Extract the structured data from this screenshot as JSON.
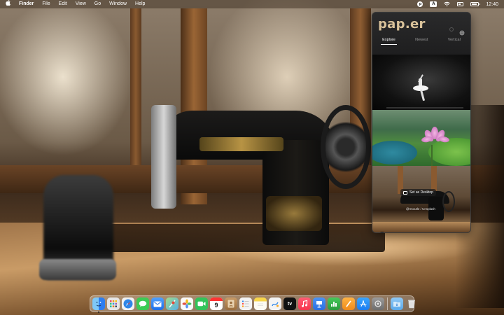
{
  "menubar": {
    "apple_icon": "apple-logo-icon",
    "app_name": "Finder",
    "menus": [
      "File",
      "Edit",
      "View",
      "Go",
      "Window",
      "Help"
    ],
    "status_icons": [
      "paper-status-icon",
      "input-source-icon",
      "wifi-icon",
      "control-center-icon",
      "battery-icon"
    ],
    "input_source": "A",
    "clock": "12:40"
  },
  "paper": {
    "logo": "pap.er",
    "tabs": [
      {
        "label": "Explore",
        "active": true
      },
      {
        "label": "Newest",
        "active": false
      },
      {
        "label": "Vertical",
        "active": false
      }
    ],
    "thumbnails": [
      {
        "subject": "ballet dancer"
      },
      {
        "subject": "lotus flower"
      },
      {
        "subject": "sewing machine"
      }
    ],
    "set_desktop_label": "Set as Desktop",
    "credit": "@Imoutle / Unsplash"
  },
  "dock": {
    "apps": [
      {
        "name": "Finder",
        "icon": "finder-icon",
        "color": "#3b8ff0",
        "running": true
      },
      {
        "name": "Launchpad",
        "icon": "launchpad-icon",
        "color": "#e8e8e8"
      },
      {
        "name": "Safari",
        "icon": "safari-icon",
        "color": "#2f86e8"
      },
      {
        "name": "Messages",
        "icon": "messages-icon",
        "color": "#3ccb55"
      },
      {
        "name": "Mail",
        "icon": "mail-icon",
        "color": "#2d7ff6"
      },
      {
        "name": "Maps",
        "icon": "maps-icon",
        "color": "#6fc47a"
      },
      {
        "name": "Photos",
        "icon": "photos-icon",
        "color": "#f4f4f4"
      },
      {
        "name": "FaceTime",
        "icon": "facetime-icon",
        "color": "#32c45a"
      },
      {
        "name": "Calendar",
        "icon": "calendar-icon",
        "color": "#ffffff",
        "day": "9"
      },
      {
        "name": "Contacts",
        "icon": "contacts-icon",
        "color": "#b98b55"
      },
      {
        "name": "Reminders",
        "icon": "reminders-icon",
        "color": "#f3f3f3"
      },
      {
        "name": "Notes",
        "icon": "notes-icon",
        "color": "#f6d64a"
      },
      {
        "name": "Freeform",
        "icon": "freeform-icon",
        "color": "#f2f2f2"
      },
      {
        "name": "TV",
        "icon": "tv-icon",
        "color": "#1b1b1b",
        "label": "tv"
      },
      {
        "name": "Music",
        "icon": "music-icon",
        "color": "#fa4058"
      },
      {
        "name": "Keynote",
        "icon": "keynote-icon",
        "color": "#3a86f1"
      },
      {
        "name": "Numbers",
        "icon": "numbers-icon",
        "color": "#3bb84a"
      },
      {
        "name": "Pages",
        "icon": "pages-icon",
        "color": "#f5a02a"
      },
      {
        "name": "App Store",
        "icon": "app-store-icon",
        "color": "#2b8ff2"
      },
      {
        "name": "System Settings",
        "icon": "system-settings-icon",
        "color": "#8a8a8a"
      }
    ],
    "trailing": [
      {
        "name": "Downloads",
        "icon": "downloads-folder-icon",
        "color": "#6cb4f0"
      },
      {
        "name": "Trash",
        "icon": "trash-icon",
        "color": "#d8d8d8"
      }
    ]
  }
}
